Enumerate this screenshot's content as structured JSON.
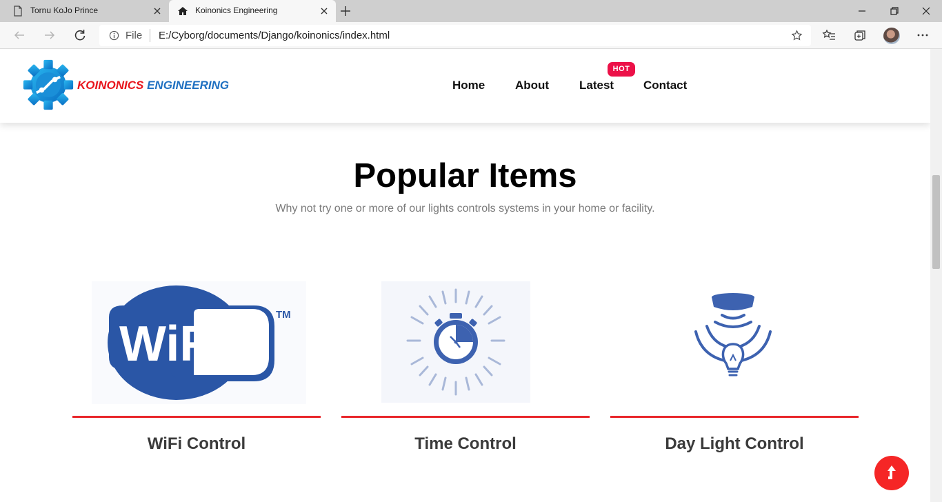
{
  "browser": {
    "tabs": [
      {
        "title": "Tornu KoJo Prince",
        "active": false,
        "icon": "page-icon"
      },
      {
        "title": "Koinonics Engineering",
        "active": true,
        "icon": "home-icon"
      }
    ],
    "address": {
      "scheme_label": "File",
      "url": "E:/Cyborg/documents/Django/koinonics/index.html"
    }
  },
  "site": {
    "logo": {
      "part1": "KOINONICS",
      "part2": "ENGINEERING",
      "color1": "#e8151c",
      "color2": "#1f70c1"
    },
    "nav": {
      "home": "Home",
      "about": "About",
      "latest": "Latest",
      "contact": "Contact",
      "badge": "HOT"
    },
    "section": {
      "title": "Popular Items",
      "subtitle": "Why not try one or more of our lights controls systems in your home or facility."
    },
    "cards": [
      {
        "title": "WiFi Control",
        "image_text": "WiFi",
        "image_mark": "TM"
      },
      {
        "title": "Time Control"
      },
      {
        "title": "Day Light Control"
      }
    ],
    "colors": {
      "accent_red": "#e8262b",
      "badge_pink": "#ec1148",
      "icon_blue": "#3d62b0"
    }
  }
}
